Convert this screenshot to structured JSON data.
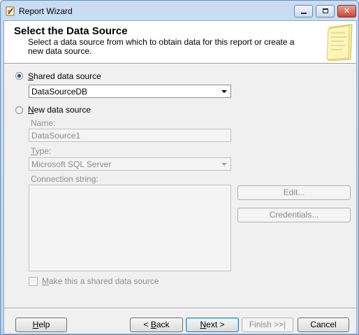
{
  "window": {
    "title": "Report Wizard",
    "minimize_label": "",
    "maximize_label": "",
    "close_label": "✕"
  },
  "header": {
    "title": "Select the Data Source",
    "description": "Select a data source from which to obtain data for this report or create a new data source."
  },
  "source": {
    "shared_label_key": "S",
    "shared_label_rest": "hared data source",
    "shared_selected": "DataSourceDB",
    "new_label_key": "N",
    "new_label_rest": "ew data source"
  },
  "new_source": {
    "name_label": "Name:",
    "name_value": "DataSource1",
    "type_label_key": "T",
    "type_label_rest": "ype:",
    "type_value": "Microsoft SQL Server",
    "connection_label": "Connection string:",
    "connection_value": "",
    "edit_label": "Edit...",
    "credentials_label": "Credentials...",
    "make_shared_key": "M",
    "make_shared_rest": "ake this a shared data source"
  },
  "footer": {
    "help_key": "H",
    "help_rest": "elp",
    "back_pre": "< ",
    "back_key": "B",
    "back_rest": "ack",
    "next_key": "N",
    "next_rest": "ext >",
    "finish_label": "Finish >>|",
    "cancel_label": "Cancel"
  }
}
